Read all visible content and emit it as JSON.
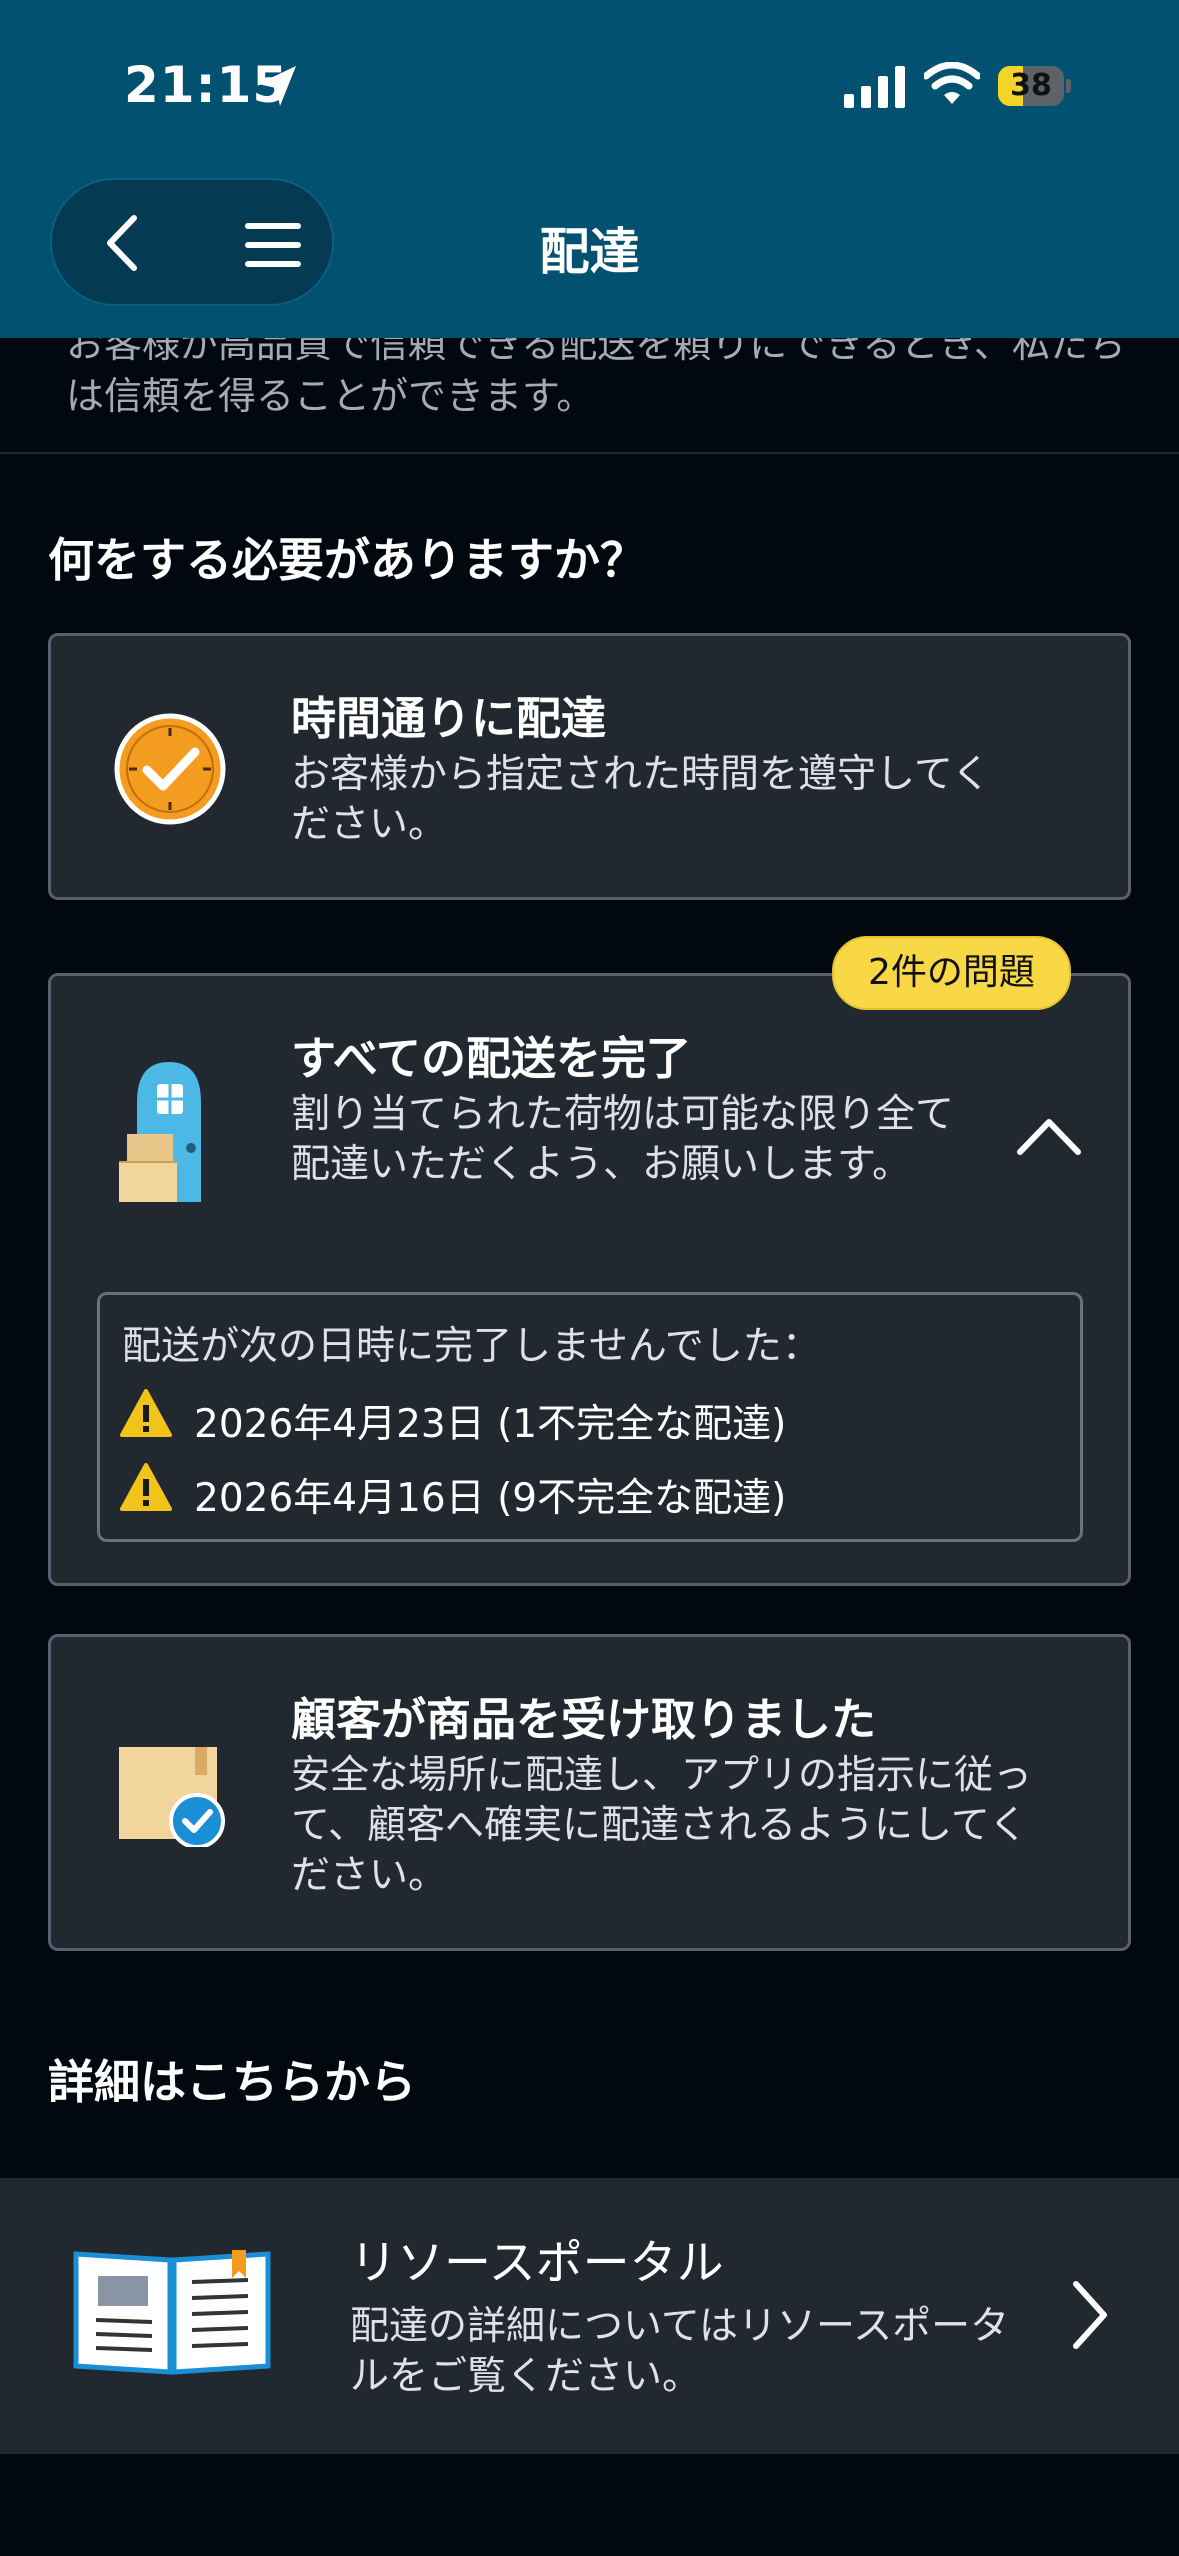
{
  "status_bar": {
    "time": "21:15",
    "battery": "38",
    "battery_level": 0.38
  },
  "header": {
    "title": "配達"
  },
  "intro": {
    "text": "お客様が高品質で信頼できる配送を頼りにできるとき、私たちは信頼を得ることができます。"
  },
  "needs_heading": "何をする必要がありますか？",
  "cards": [
    {
      "title": "時間通りに配達",
      "description": "お客様から指定された時間を遵守してください。",
      "icon": "clock-check-icon"
    },
    {
      "title": "すべての配送を完了",
      "description": "割り当てられた荷物は可能な限り全て配達いただくよう、お願いします。",
      "icon": "door-packages-icon",
      "badge": "2件の問題",
      "missed": {
        "title": "配送が次の日時に完了しませんでした：",
        "items": [
          "2026年4月23日 (1不完全な配達)",
          "2026年4月16日 (9不完全な配達)"
        ]
      }
    },
    {
      "title": "顧客が商品を受け取りました",
      "description": "安全な場所に配達し、アプリの指示に従って、顧客へ確実に配達されるようにしてください。",
      "icon": "package-check-icon"
    }
  ],
  "details_heading": "詳細はこちらから",
  "resource": {
    "title": "リソースポータル",
    "description": "配達の詳細についてはリソースポータルをご覧ください。",
    "icon": "book-icon"
  },
  "colors": {
    "header_bg": "#035171",
    "page_bg": "#02080f",
    "card_bg": "#212830",
    "badge_bg": "#f8d845",
    "warning": "#f2c31b",
    "clock_orange": "#f39c1f",
    "door_blue": "#4cb8e6"
  }
}
